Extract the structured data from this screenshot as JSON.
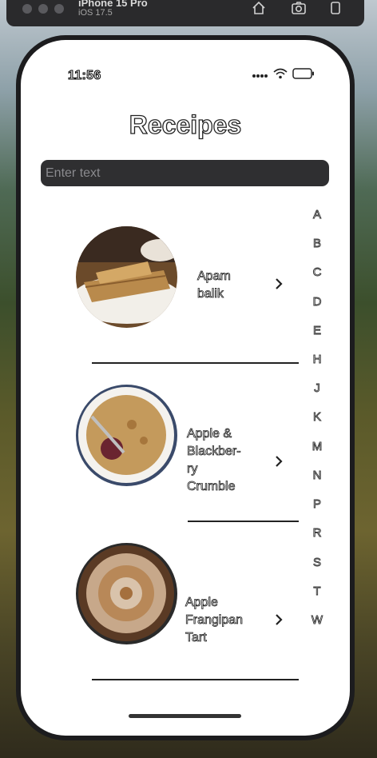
{
  "simulator": {
    "device_name": "iPhone 15 Pro",
    "os_version": "iOS 17.5"
  },
  "status_bar": {
    "time": "11:56"
  },
  "page": {
    "title": "Receipes",
    "search_placeholder": "Enter text"
  },
  "recipes": [
    {
      "name_lines": [
        "Apam",
        "balik"
      ]
    },
    {
      "name_lines": [
        "Apple &",
        "Blackber-",
        "ry",
        "Crumble"
      ]
    },
    {
      "name_lines": [
        "Apple",
        "Frangipan",
        "Tart"
      ]
    }
  ],
  "index_letters": [
    "A",
    "B",
    "C",
    "D",
    "E",
    "H",
    "J",
    "K",
    "M",
    "N",
    "P",
    "R",
    "S",
    "T",
    "W"
  ],
  "icons": {
    "home": "home-icon",
    "screenshot": "camera-icon",
    "rotate": "rotate-icon",
    "signal": "signal-dots-icon",
    "wifi": "wifi-icon",
    "battery": "battery-icon",
    "chevron": "chevron-right-icon"
  }
}
